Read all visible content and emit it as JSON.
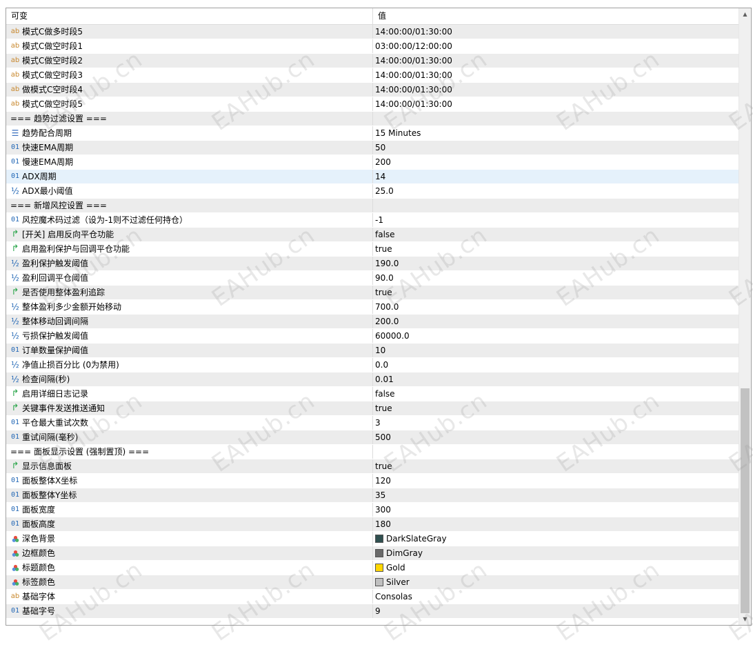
{
  "header": {
    "col_name": "可变",
    "col_value": "值"
  },
  "rows": [
    {
      "icon": "ab",
      "name": "模式C做多时段5",
      "value": "14:00:00/01:30:00"
    },
    {
      "icon": "ab",
      "name": "模式C做空时段1",
      "value": "03:00:00/12:00:00"
    },
    {
      "icon": "ab",
      "name": "模式C做空时段2",
      "value": "14:00:00/01:30:00"
    },
    {
      "icon": "ab",
      "name": "模式C做空时段3",
      "value": "14:00:00/01:30:00"
    },
    {
      "icon": "ab",
      "name": "做模式C空时段4",
      "value": "14:00:00/01:30:00"
    },
    {
      "icon": "ab",
      "name": "模式C做空时段5",
      "value": "14:00:00/01:30:00"
    },
    {
      "icon": "none",
      "name": "=== 趋势过滤设置 ===",
      "value": ""
    },
    {
      "icon": "enum",
      "name": "趋势配合周期",
      "value": "15 Minutes"
    },
    {
      "icon": "01",
      "name": "快速EMA周期",
      "value": "50"
    },
    {
      "icon": "01",
      "name": "慢速EMA周期",
      "value": "200"
    },
    {
      "icon": "01",
      "name": "ADX周期",
      "value": "14",
      "selected": true
    },
    {
      "icon": "half",
      "name": "ADX最小阈值",
      "value": "25.0"
    },
    {
      "icon": "none",
      "name": "=== 新增风控设置 ===",
      "value": ""
    },
    {
      "icon": "01",
      "name": "风控魔术码过滤（设为-1则不过滤任何持仓）",
      "value": "-1"
    },
    {
      "icon": "bool",
      "name": "[开关] 启用反向平仓功能",
      "value": "false"
    },
    {
      "icon": "bool",
      "name": "启用盈利保护与回调平仓功能",
      "value": "true"
    },
    {
      "icon": "half",
      "name": "盈利保护触发阈值",
      "value": "190.0"
    },
    {
      "icon": "half",
      "name": "盈利回调平仓阈值",
      "value": "90.0"
    },
    {
      "icon": "bool",
      "name": "是否使用整体盈利追踪",
      "value": "true"
    },
    {
      "icon": "half",
      "name": "整体盈利多少金额开始移动",
      "value": "700.0"
    },
    {
      "icon": "half",
      "name": "整体移动回调间隔",
      "value": "200.0"
    },
    {
      "icon": "half",
      "name": "亏损保护触发阈值",
      "value": "60000.0"
    },
    {
      "icon": "01",
      "name": "订单数量保护阈值",
      "value": "10"
    },
    {
      "icon": "half",
      "name": "净值止损百分比 (0为禁用)",
      "value": "0.0"
    },
    {
      "icon": "half",
      "name": "检查间隔(秒)",
      "value": "0.01"
    },
    {
      "icon": "bool",
      "name": "启用详细日志记录",
      "value": "false"
    },
    {
      "icon": "bool",
      "name": "关键事件发送推送通知",
      "value": "true"
    },
    {
      "icon": "01",
      "name": "平仓最大重试次数",
      "value": "3"
    },
    {
      "icon": "01",
      "name": "重试间隔(毫秒)",
      "value": "500"
    },
    {
      "icon": "none",
      "name": "=== 面板显示设置 (强制置顶) ===",
      "value": ""
    },
    {
      "icon": "bool",
      "name": "显示信息面板",
      "value": "true"
    },
    {
      "icon": "01",
      "name": "面板整体X坐标",
      "value": "120"
    },
    {
      "icon": "01",
      "name": "面板整体Y坐标",
      "value": "35"
    },
    {
      "icon": "01",
      "name": "面板宽度",
      "value": "300"
    },
    {
      "icon": "01",
      "name": "面板高度",
      "value": "180"
    },
    {
      "icon": "color",
      "name": "深色背景",
      "value": "DarkSlateGray",
      "swatch": "#2f4f4f"
    },
    {
      "icon": "color",
      "name": "边框颜色",
      "value": "DimGray",
      "swatch": "#696969"
    },
    {
      "icon": "color",
      "name": "标题颜色",
      "value": "Gold",
      "swatch": "#ffd700"
    },
    {
      "icon": "color",
      "name": "标签颜色",
      "value": "Silver",
      "swatch": "#c0c0c0"
    },
    {
      "icon": "ab",
      "name": "基础字体",
      "value": "Consolas"
    },
    {
      "icon": "01",
      "name": "基础字号",
      "value": "9"
    }
  ],
  "watermark": "EAHub.cn",
  "colors": {
    "row_alt": "#ececec",
    "row_selected": "#e5f1fb",
    "icon_string": "#c7862a",
    "icon_int": "#1e64b4",
    "icon_bool": "#2aa54a"
  }
}
